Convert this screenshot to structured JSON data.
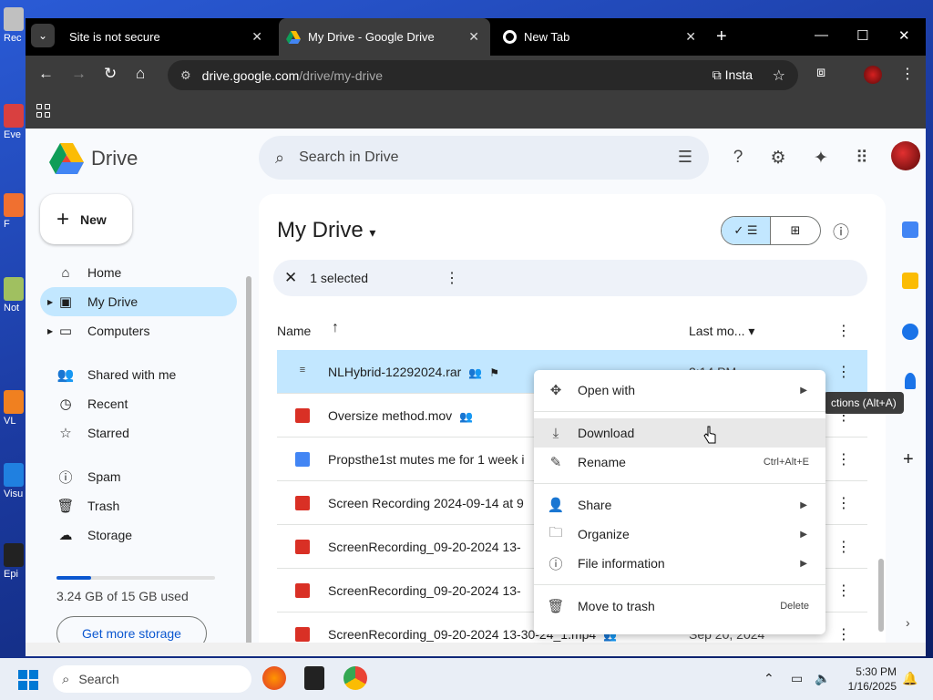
{
  "desktop": {
    "icons": [
      {
        "label": "Rec",
        "color": "#c0c0c0"
      },
      {
        "label": "Eve",
        "color": "#d94040"
      },
      {
        "label": "F",
        "color": "#f07030"
      },
      {
        "label": "Not",
        "color": "#a0c060"
      },
      {
        "label": "VL",
        "color": "#f08020"
      },
      {
        "label": "Visu",
        "color": "#2080e0"
      },
      {
        "label": "Epi",
        "color": "#222222"
      }
    ]
  },
  "browser": {
    "tabs": [
      {
        "title": "Site is not secure",
        "close": "✕"
      },
      {
        "title": "My Drive - Google Drive",
        "close": "✕"
      },
      {
        "title": "New Tab",
        "close": "✕"
      }
    ],
    "new_tab": "+",
    "window": {
      "minimize": "—",
      "maximize": "☐",
      "close": "✕"
    },
    "url_host": "drive.google.com",
    "url_path": "/drive/my-drive",
    "install_label": "Insta"
  },
  "drive": {
    "app_name": "Drive",
    "search_placeholder": "Search in Drive",
    "new_label": "New",
    "nav": [
      {
        "label": "Home",
        "icon": "⌂"
      },
      {
        "label": "My Drive",
        "icon": "▣"
      },
      {
        "label": "Computers",
        "icon": "▭"
      },
      {
        "label": "Shared with me",
        "icon": "👥"
      },
      {
        "label": "Recent",
        "icon": "◷"
      },
      {
        "label": "Starred",
        "icon": "☆"
      },
      {
        "label": "Spam",
        "icon": "ⓘ"
      },
      {
        "label": "Trash",
        "icon": "🗑"
      },
      {
        "label": "Storage",
        "icon": "☁"
      }
    ],
    "storage_text": "3.24 GB of 15 GB used",
    "storage_fraction": 0.216,
    "get_more": "Get more storage",
    "title": "My Drive",
    "selection": "1 selected",
    "columns": {
      "name": "Name",
      "modified": "Last mo..."
    },
    "files": [
      {
        "name": "NLHybrid-12292024.rar",
        "date": "2:14 PM",
        "shared": true,
        "flag": true,
        "type": "archive"
      },
      {
        "name": "Oversize method.mov",
        "date": "",
        "shared": true,
        "type": "video"
      },
      {
        "name": "Propsthe1st mutes me for 1 week i",
        "date": "",
        "type": "doc"
      },
      {
        "name": "Screen Recording 2024-09-14 at 9",
        "date": "",
        "type": "video"
      },
      {
        "name": "ScreenRecording_09-20-2024 13-",
        "date": "",
        "type": "video"
      },
      {
        "name": "ScreenRecording_09-20-2024 13-",
        "date": "",
        "type": "video"
      },
      {
        "name": "ScreenRecording_09-20-2024 13-30-24_1.mp4",
        "date": "Sep 20, 2024",
        "shared": true,
        "type": "video"
      }
    ],
    "tooltip": "ctions (Alt+A)"
  },
  "context_menu": {
    "items": [
      {
        "label": "Open with",
        "icon": "✥",
        "submenu": true
      },
      {
        "label": "Download",
        "icon": "⤓",
        "hover": true
      },
      {
        "label": "Rename",
        "icon": "✎",
        "shortcut": "Ctrl+Alt+E"
      },
      {
        "label": "Share",
        "icon": "👤",
        "submenu": true
      },
      {
        "label": "Organize",
        "icon": "🗀",
        "submenu": true
      },
      {
        "label": "File information",
        "icon": "ⓘ",
        "submenu": true
      },
      {
        "label": "Move to trash",
        "icon": "🗑",
        "shortcut": "Delete"
      }
    ]
  },
  "taskbar": {
    "search": "Search",
    "time": "5:30 PM",
    "date": "1/16/2025"
  },
  "colors": {
    "selected_bg": "#c2e7ff",
    "accent": "#0b57d0"
  }
}
